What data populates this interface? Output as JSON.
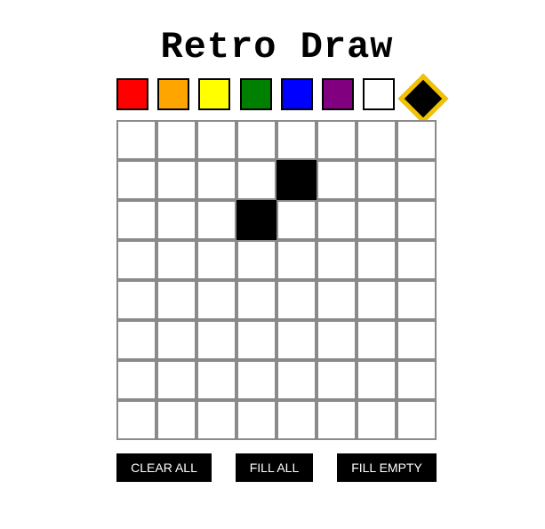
{
  "title": "Retro Draw",
  "palette": [
    {
      "name": "red",
      "color": "#ff0000"
    },
    {
      "name": "orange",
      "color": "#ffa500"
    },
    {
      "name": "yellow",
      "color": "#ffff00"
    },
    {
      "name": "green",
      "color": "#008000"
    },
    {
      "name": "blue",
      "color": "#0000ff"
    },
    {
      "name": "purple",
      "color": "#800080"
    },
    {
      "name": "white",
      "color": "#ffffff"
    },
    {
      "name": "black",
      "color": "#000000"
    }
  ],
  "selected_color": "black",
  "selection_highlight_color": "#f2c200",
  "grid": {
    "rows": 8,
    "cols": 8,
    "empty_color": "#ffffff",
    "filled_cells": [
      {
        "row": 1,
        "col": 4,
        "color": "#000000"
      },
      {
        "row": 2,
        "col": 3,
        "color": "#000000"
      }
    ]
  },
  "controls": {
    "clear_all_label": "CLEAR ALL",
    "fill_all_label": "FILL ALL",
    "fill_empty_label": "FILL EMPTY"
  }
}
